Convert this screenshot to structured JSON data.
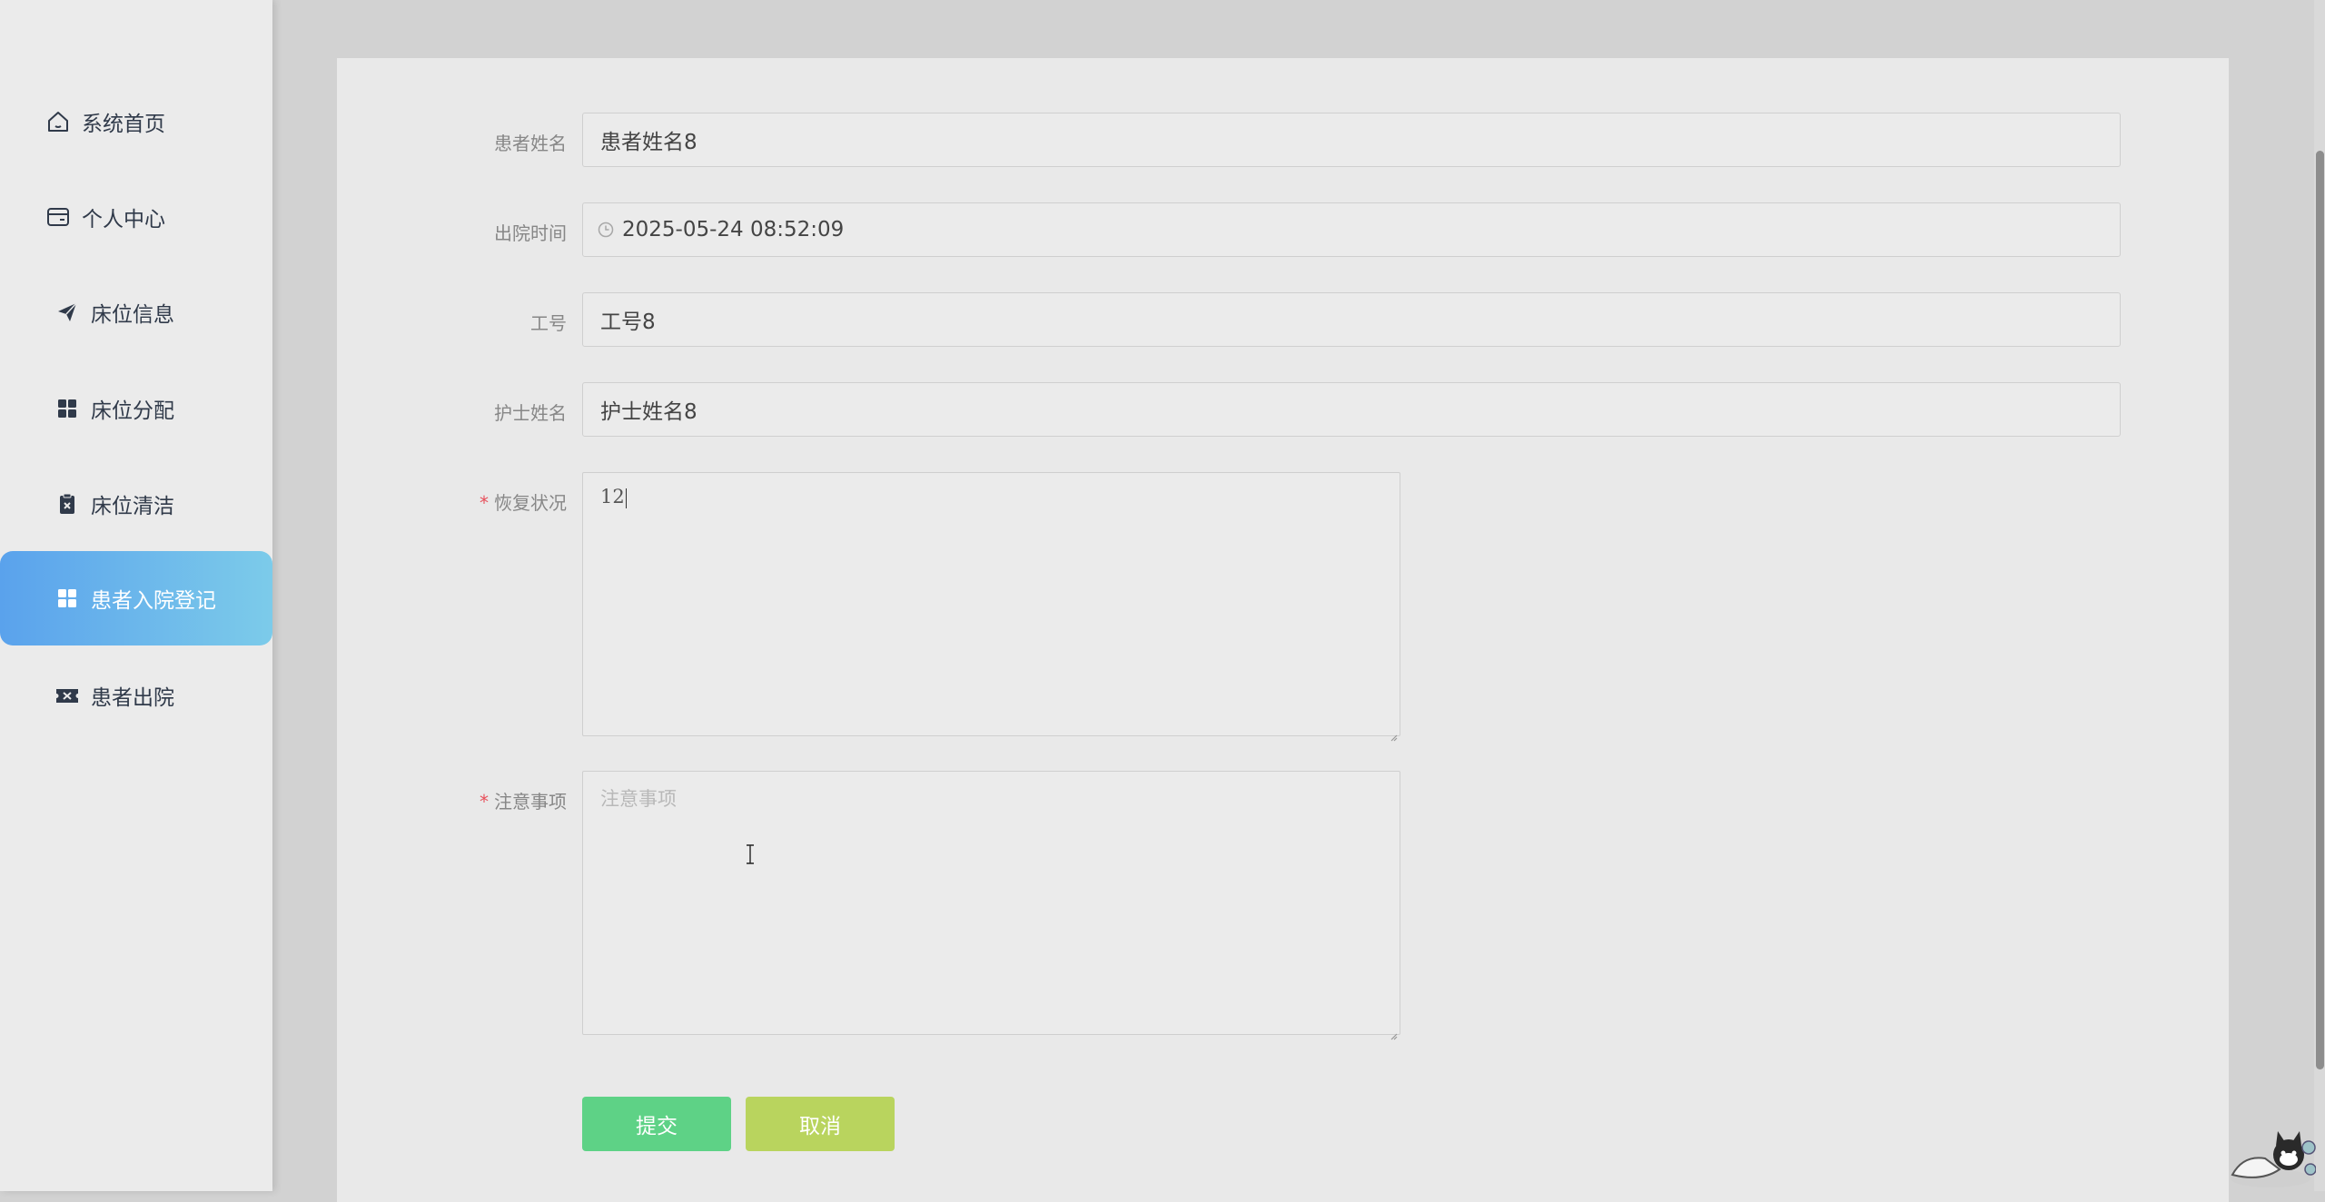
{
  "sidebar": {
    "items": [
      {
        "label": "系统首页",
        "icon": "home-icon"
      },
      {
        "label": "个人中心",
        "icon": "wallet-icon"
      },
      {
        "label": "床位信息",
        "icon": "paper-plane-icon"
      },
      {
        "label": "床位分配",
        "icon": "grid-icon"
      },
      {
        "label": "床位清洁",
        "icon": "clipboard-x-icon"
      },
      {
        "label": "患者入院登记",
        "icon": "grid-icon",
        "active": true
      },
      {
        "label": "患者出院",
        "icon": "ticket-icon"
      }
    ]
  },
  "form": {
    "patient_name": {
      "label": "患者姓名",
      "value": "患者姓名8"
    },
    "discharge_time": {
      "label": "出院时间",
      "value": "2025-05-24 08:52:09",
      "icon": "clock-icon"
    },
    "staff_id": {
      "label": "工号",
      "value": "工号8"
    },
    "nurse_name": {
      "label": "护士姓名",
      "value": "护士姓名8"
    },
    "recovery_status": {
      "label": "恢复状况",
      "required_mark": "*",
      "value": "12"
    },
    "notes": {
      "label": "注意事项",
      "required_mark": "*",
      "placeholder": "注意事项",
      "value": ""
    }
  },
  "buttons": {
    "submit": "提交",
    "cancel": "取消"
  },
  "colors": {
    "accent_gradient_start": "#5aa2ec",
    "accent_gradient_end": "#7ccbea",
    "submit": "#5ed286",
    "cancel": "#b9d45e",
    "required": "#e8505b"
  }
}
